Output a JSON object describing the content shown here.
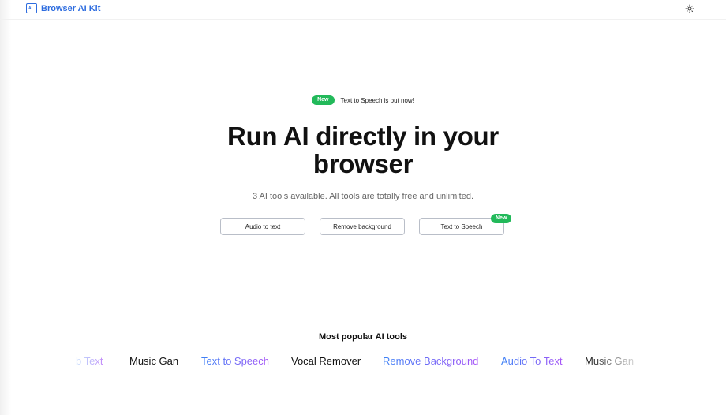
{
  "brand": {
    "name": "Browser AI Kit",
    "icon_label": "AI",
    "color": "#2d6cdf"
  },
  "header": {
    "theme_icon": "sun-icon"
  },
  "announcement": {
    "badge": "New",
    "text": "Text to Speech is out now!",
    "badge_color": "#22b95a"
  },
  "hero": {
    "title_line1": "Run AI directly in your",
    "title_line2": "browser",
    "subtitle": "3 AI tools available. All tools are totally free and unlimited."
  },
  "tools": [
    {
      "label": "Audio to text"
    },
    {
      "label": "Remove background"
    },
    {
      "label": "Text to Speech",
      "badge": "New"
    }
  ],
  "popular": {
    "heading": "Most popular AI tools",
    "items": [
      {
        "label": "b Text",
        "style": "gradient"
      },
      {
        "label": "Music Gan",
        "style": "plain"
      },
      {
        "label": "Text to Speech",
        "style": "gradient"
      },
      {
        "label": "Vocal Remover",
        "style": "plain"
      },
      {
        "label": "Remove Background",
        "style": "gradient"
      },
      {
        "label": "Audio To Text",
        "style": "gradient"
      },
      {
        "label": "Music Gan",
        "style": "plain"
      }
    ]
  }
}
